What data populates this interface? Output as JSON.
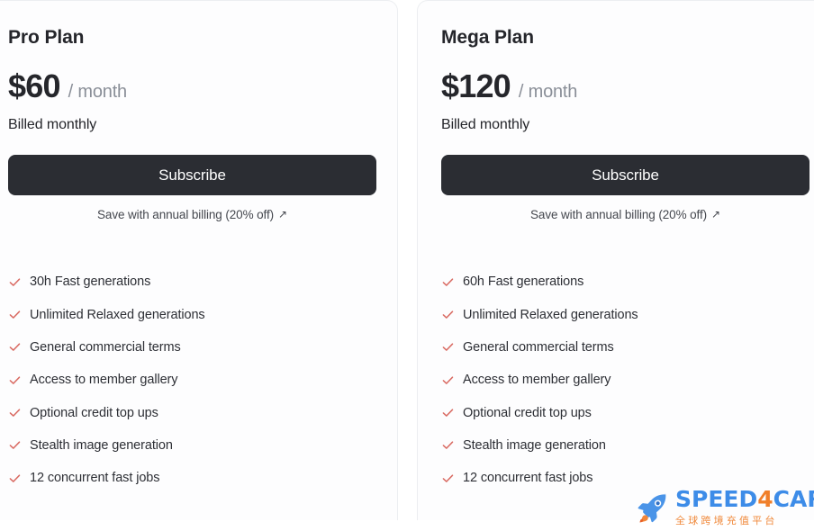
{
  "page": {
    "background_color": "#ffffff",
    "card_background_color": "#fdfdfe",
    "card_border_color": "#eceef1",
    "button_color": "#2b2d33",
    "check_color": "#d96a62"
  },
  "plans": [
    {
      "name": "Pro Plan",
      "price": "$60",
      "period": "/ month",
      "billing_note": "Billed monthly",
      "subscribe_label": "Subscribe",
      "annual_link_label": "Save with annual billing (20% off)",
      "annual_link_icon": "arrow-up-right-icon",
      "features": [
        "30h Fast generations",
        "Unlimited Relaxed generations",
        "General commercial terms",
        "Access to member gallery",
        "Optional credit top ups",
        "Stealth image generation",
        "12 concurrent fast jobs"
      ]
    },
    {
      "name": "Mega Plan",
      "price": "$120",
      "period": "/ month",
      "billing_note": "Billed monthly",
      "subscribe_label": "Subscribe",
      "annual_link_label": "Save with annual billing (20% off)",
      "annual_link_icon": "arrow-up-right-icon",
      "features": [
        "60h Fast generations",
        "Unlimited Relaxed generations",
        "General commercial terms",
        "Access to member gallery",
        "Optional credit top ups",
        "Stealth image generation",
        "12 concurrent fast jobs"
      ]
    }
  ],
  "watermark": {
    "icon": "rocket-icon",
    "word_part1": "SPEED",
    "word_four": "4",
    "word_part2": "CARD",
    "subtitle": "全球跨境充值平台",
    "brand_blue": "#3d8ce8",
    "brand_orange": "#f07f2a"
  }
}
